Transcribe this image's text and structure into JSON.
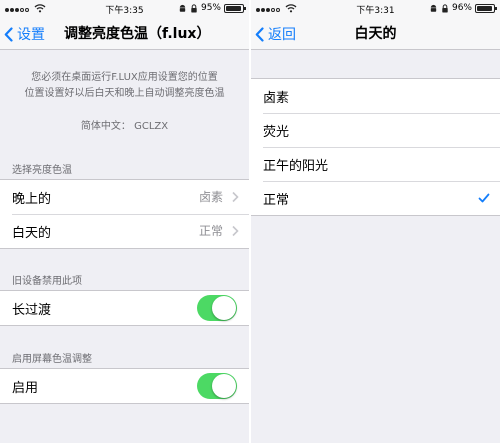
{
  "left": {
    "status": {
      "time": "下午3:35",
      "battery": "95%",
      "battery_level": 95
    },
    "nav": {
      "back_label": "设置",
      "title": "调整亮度色温（f.lux）"
    },
    "notice": {
      "line1": "您必须在桌面运行F.LUX应用设置您的位置",
      "line2": "位置设置好以后白天和晚上自动调整亮度色温",
      "credit": "简体中文： GCLZX"
    },
    "section_brightness": {
      "header": "选择亮度色温",
      "rows": [
        {
          "label": "晚上的",
          "value": "卤素"
        },
        {
          "label": "白天的",
          "value": "正常"
        }
      ]
    },
    "section_old_devices": {
      "header": "旧设备禁用此项",
      "row_label": "长过渡",
      "enabled": true
    },
    "section_screen_temp": {
      "header": "启用屏幕色温调整",
      "row_label": "启用",
      "enabled": true
    }
  },
  "right": {
    "status": {
      "time": "下午3:31",
      "battery": "96%",
      "battery_level": 96
    },
    "nav": {
      "back_label": "返回",
      "title": "白天的"
    },
    "options": [
      {
        "label": "卤素",
        "selected": false
      },
      {
        "label": "荧光",
        "selected": false
      },
      {
        "label": "正午的阳光",
        "selected": false
      },
      {
        "label": "正常",
        "selected": true
      }
    ]
  },
  "colors": {
    "accent": "#147efb",
    "switch_on": "#4cd964",
    "background": "#efeff4"
  },
  "icons": [
    "signal-icon",
    "wifi-icon",
    "android-icon",
    "lock-icon",
    "battery-icon",
    "back-chevron-icon",
    "disclosure-chevron-icon",
    "checkmark-icon"
  ]
}
